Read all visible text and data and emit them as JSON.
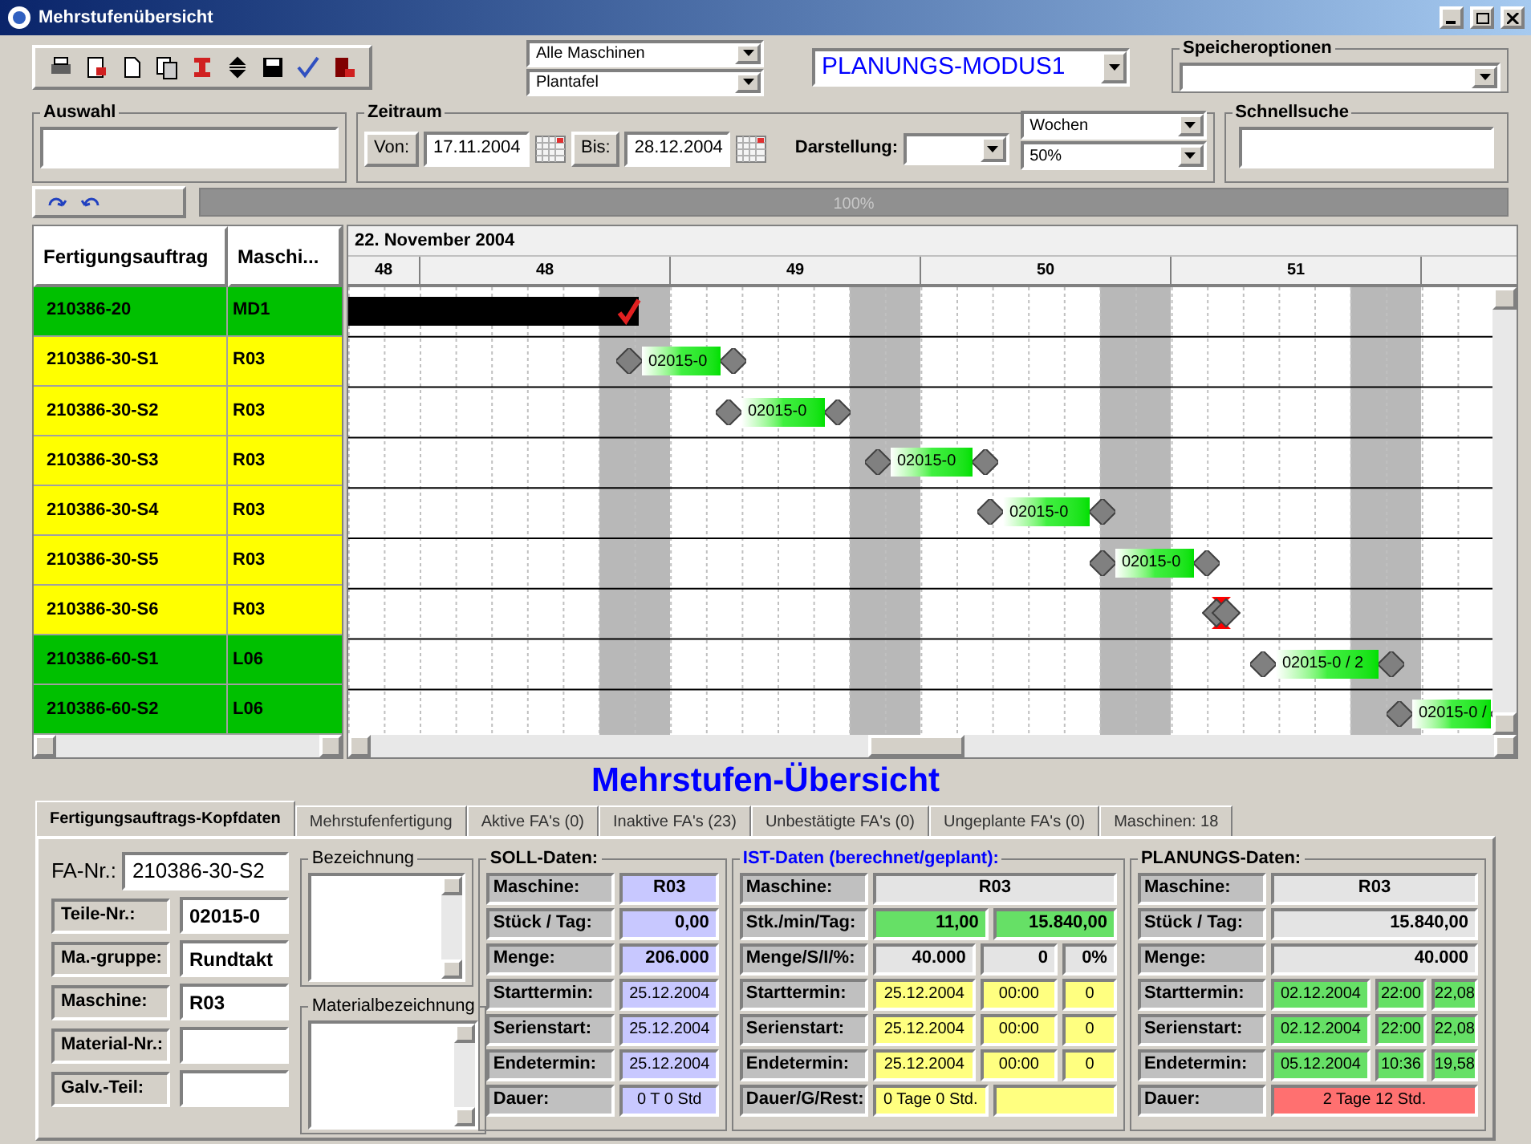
{
  "window": {
    "title": "Mehrstufenübersicht"
  },
  "filters": {
    "machines": "Alle Maschinen",
    "view": "Plantafel",
    "mode": "PLANUNGS-MODUS1",
    "save_label": "Speicheroptionen"
  },
  "auswahl": {
    "label": "Auswahl"
  },
  "zeitraum": {
    "label": "Zeitraum",
    "from_label": "Von:",
    "from": "17.11.2004",
    "to_label": "Bis:",
    "to": "28.12.2004"
  },
  "darstellung": {
    "label": "Darstellung:",
    "unit": "Wochen",
    "zoom": "50%"
  },
  "schnellsuche": {
    "label": "Schnellsuche"
  },
  "progress": {
    "level": 1,
    "reading": "100%"
  },
  "table": {
    "columns": [
      "Fertigungsauftrag",
      "Maschi..."
    ],
    "rows": [
      {
        "order": "210386-20",
        "machine": "MD1",
        "color": "#00c000"
      },
      {
        "order": "210386-30-S1",
        "machine": "R03",
        "color": "#ffff00"
      },
      {
        "order": "210386-30-S2",
        "machine": "R03",
        "color": "#ffff00"
      },
      {
        "order": "210386-30-S3",
        "machine": "R03",
        "color": "#ffff00"
      },
      {
        "order": "210386-30-S4",
        "machine": "R03",
        "color": "#ffff00"
      },
      {
        "order": "210386-30-S5",
        "machine": "R03",
        "color": "#ffff00"
      },
      {
        "order": "210386-30-S6",
        "machine": "R03",
        "color": "#ffff00"
      },
      {
        "order": "210386-60-S1",
        "machine": "L06",
        "color": "#00c000"
      },
      {
        "order": "210386-60-S2",
        "machine": "L06",
        "color": "#00c000"
      }
    ]
  },
  "gantt": {
    "month": "22. November 2004",
    "weeks": [
      "48",
      "48",
      "49",
      "50",
      "51"
    ],
    "bars": [
      {
        "kind": "done"
      },
      {
        "kind": "task",
        "label": "02015-0"
      },
      {
        "kind": "task",
        "label": "02015-0"
      },
      {
        "kind": "task",
        "label": "02015-0"
      },
      {
        "kind": "task",
        "label": "02015-0"
      },
      {
        "kind": "task",
        "label": "02015-0"
      },
      {
        "kind": "milestone"
      },
      {
        "kind": "task",
        "label": "02015-0 / 2"
      },
      {
        "kind": "task",
        "label": "02015-0 /"
      }
    ]
  },
  "heading": "Mehrstufen-Übersicht",
  "tabs": [
    {
      "label": "Fertigungsauftrags-Kopfdaten",
      "selected": true
    },
    {
      "label": "Mehrstufenfertigung",
      "selected": false
    },
    {
      "label": "Aktive FA's  (0)",
      "selected": false
    },
    {
      "label": "Inaktive FA's  (23)",
      "selected": false
    },
    {
      "label": "Unbestätigte FA's  (0)",
      "selected": false
    },
    {
      "label": "Ungeplante FA's (0)",
      "selected": false
    },
    {
      "label": "Maschinen: 18",
      "selected": false
    }
  ],
  "kopfdaten": {
    "fa_label": "FA-Nr.:",
    "fa_value": "210386-30-S2",
    "fields": [
      {
        "label": "Teile-Nr.:",
        "value": "02015-0"
      },
      {
        "label": "Ma.-gruppe:",
        "value": "Rundtakt"
      },
      {
        "label": "Maschine:",
        "value": "R03"
      },
      {
        "label": "Material-Nr.:"
      },
      {
        "label": "Galv.-Teil:"
      }
    ]
  },
  "bezeichnung": {
    "label": "Bezeichnung"
  },
  "materialbezeichnung": {
    "label": "Materialbezeichnung"
  },
  "soll": {
    "title": "SOLL-Daten:",
    "rows": [
      {
        "label": "Maschine:",
        "cells": [
          {
            "value": "R03",
            "kind": "center",
            "color": "#c8c8ff"
          }
        ]
      },
      {
        "label": "Stück / Tag:",
        "cells": [
          {
            "value": "0,00",
            "kind": "figure",
            "color": "#c8c8ff"
          }
        ]
      },
      {
        "label": "Menge:",
        "cells": [
          {
            "value": "206.000",
            "kind": "figure",
            "color": "#c8c8ff"
          }
        ]
      },
      {
        "label": "Starttermin:",
        "cells": [
          {
            "value": "25.12.2004",
            "kind": "date",
            "color": "#c8c8ff"
          }
        ]
      },
      {
        "label": "Serienstart:",
        "cells": [
          {
            "value": "25.12.2004",
            "kind": "date",
            "color": "#c8c8ff"
          }
        ]
      },
      {
        "label": "Endetermin:",
        "cells": [
          {
            "value": "25.12.2004",
            "kind": "date",
            "color": "#c8c8ff"
          }
        ]
      },
      {
        "label": "Dauer:",
        "cells": [
          {
            "value": "0 T 0 Std",
            "kind": "date",
            "color": "#c8c8ff"
          }
        ]
      }
    ]
  },
  "ist": {
    "title": "IST-Daten (berechnet/geplant):",
    "rows": [
      {
        "label": "Maschine:",
        "cells": [
          {
            "value": "R03",
            "kind": "center",
            "color": "#e4e4e4"
          }
        ]
      },
      {
        "label": "Stk./min/Tag:",
        "cells": [
          {
            "value": "11,00",
            "kind": "figure",
            "color": "#66e066"
          },
          {
            "value": "15.840,00",
            "kind": "figure",
            "color": "#66e066"
          }
        ]
      },
      {
        "label": "Menge/S/I/%:",
        "cells": [
          {
            "value": "40.000",
            "kind": "figure",
            "color": "#e4e4e4"
          },
          {
            "value": "0",
            "kind": "figure",
            "color": "#e4e4e4"
          },
          {
            "value": "0%",
            "kind": "figure",
            "color": "#e4e4e4"
          }
        ]
      },
      {
        "label": "Starttermin:",
        "cells": [
          {
            "value": "25.12.2004",
            "kind": "date",
            "color": "#ffff80"
          },
          {
            "value": "00:00",
            "kind": "date",
            "color": "#ffff80"
          },
          {
            "value": "0",
            "kind": "date",
            "color": "#ffff80"
          }
        ]
      },
      {
        "label": "Serienstart:",
        "cells": [
          {
            "value": "25.12.2004",
            "kind": "date",
            "color": "#ffff80"
          },
          {
            "value": "00:00",
            "kind": "date",
            "color": "#ffff80"
          },
          {
            "value": "0",
            "kind": "date",
            "color": "#ffff80"
          }
        ]
      },
      {
        "label": "Endetermin:",
        "cells": [
          {
            "value": "25.12.2004",
            "kind": "date",
            "color": "#ffff80"
          },
          {
            "value": "00:00",
            "kind": "date",
            "color": "#ffff80"
          },
          {
            "value": "0",
            "kind": "date",
            "color": "#ffff80"
          }
        ]
      },
      {
        "label": "Dauer/G/Rest:",
        "cells": [
          {
            "value": "0 Tage  0 Std.",
            "kind": "date",
            "color": "#ffff80"
          },
          {
            "kind": "date",
            "color": "#ffff80"
          }
        ]
      }
    ]
  },
  "planung": {
    "title": "PLANUNGS-Daten:",
    "rows": [
      {
        "label": "Maschine:",
        "cells": [
          {
            "value": "R03",
            "kind": "center",
            "color": "#e4e4e4"
          }
        ]
      },
      {
        "label": "Stück / Tag:",
        "cells": [
          {
            "value": "15.840,00",
            "kind": "figure",
            "color": "#e4e4e4"
          }
        ]
      },
      {
        "label": "Menge:",
        "cells": [
          {
            "value": "40.000",
            "kind": "figure",
            "color": "#e4e4e4"
          }
        ]
      },
      {
        "label": "Starttermin:",
        "cells": [
          {
            "value": "02.12.2004",
            "kind": "date",
            "color": "#66e066"
          },
          {
            "value": "22:00",
            "kind": "date",
            "color": "#66e066"
          },
          {
            "value": "22,08",
            "kind": "date",
            "color": "#66e066"
          }
        ]
      },
      {
        "label": "Serienstart:",
        "cells": [
          {
            "value": "02.12.2004",
            "kind": "date",
            "color": "#66e066"
          },
          {
            "value": "22:00",
            "kind": "date",
            "color": "#66e066"
          },
          {
            "value": "22,08",
            "kind": "date",
            "color": "#66e066"
          }
        ]
      },
      {
        "label": "Endetermin:",
        "cells": [
          {
            "value": "05.12.2004",
            "kind": "date",
            "color": "#66e066"
          },
          {
            "value": "10:36",
            "kind": "date",
            "color": "#66e066"
          },
          {
            "value": "19,58",
            "kind": "date",
            "color": "#66e066"
          }
        ]
      },
      {
        "label": "Dauer:",
        "cells": [
          {
            "value": "2 Tage  12 Std.",
            "kind": "date",
            "color": "#ff7070"
          }
        ]
      }
    ]
  }
}
